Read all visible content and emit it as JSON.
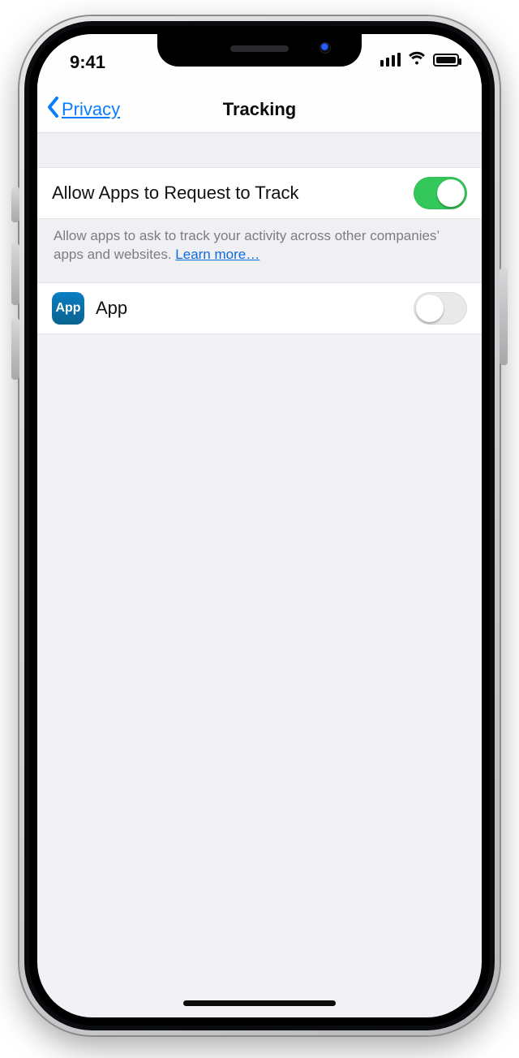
{
  "status": {
    "time": "9:41"
  },
  "nav": {
    "back_label": "Privacy",
    "title": "Tracking"
  },
  "cells": {
    "allow_tracking": {
      "label": "Allow Apps to Request to Track",
      "on": true
    },
    "footer": {
      "text": "Allow apps to ask to track your activity across other companies’ apps and websites.",
      "link": "Learn more…"
    },
    "app_list": [
      {
        "name": "App",
        "icon_text": "App",
        "on": false
      }
    ]
  },
  "colors": {
    "accent_blue": "#0a7cff",
    "toggle_green": "#34c759"
  }
}
